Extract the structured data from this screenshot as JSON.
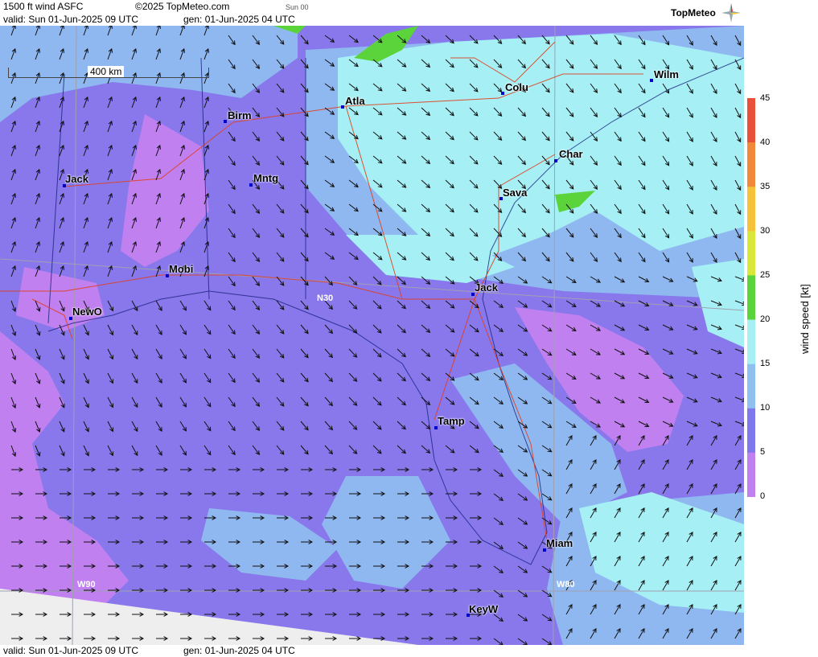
{
  "header": {
    "product": "1500 ft wind ASFC",
    "copyright": "©2025 TopMeteo.com",
    "day": "Sun 00",
    "valid": "valid:  Sun  01-Jun-2025  09 UTC",
    "gen": "gen: 01-Jun-2025 04 UTC",
    "logo": "TopMeteo"
  },
  "footer": {
    "valid": "valid:  Sun  01-Jun-2025  09 UTC",
    "gen": "gen: 01-Jun-2025 04 UTC"
  },
  "scale": "400 km",
  "grid_labels": {
    "n30": "N30",
    "w90": "W90",
    "w80": "W80"
  },
  "cities": [
    {
      "name": "Birm"
    },
    {
      "name": "Atla"
    },
    {
      "name": "Colu"
    },
    {
      "name": "Wilm"
    },
    {
      "name": "Jack"
    },
    {
      "name": "Mntg"
    },
    {
      "name": "Char"
    },
    {
      "name": "Sava"
    },
    {
      "name": "Mobi"
    },
    {
      "name": "NewO"
    },
    {
      "name": "Jack"
    },
    {
      "name": "Tamp"
    },
    {
      "name": "Miam"
    },
    {
      "name": "KeyW"
    }
  ],
  "legend": {
    "unit": "wind speed  [kt]",
    "ticks": [
      "45",
      "40",
      "35",
      "30",
      "25",
      "20",
      "15",
      "10",
      "5",
      "0"
    ],
    "colors": [
      "#e8503a",
      "#f08a3a",
      "#f5c23a",
      "#d8e83a",
      "#5ad43a",
      "#a6f0f5",
      "#8fc0f0",
      "#7f78ec",
      "#c080f0"
    ]
  },
  "colors": {
    "calm": "#c080f0",
    "light": "#8878ec",
    "moderate": "#8fb8f0",
    "fresh": "#a6f0f5",
    "strong": "#5ad43a"
  }
}
